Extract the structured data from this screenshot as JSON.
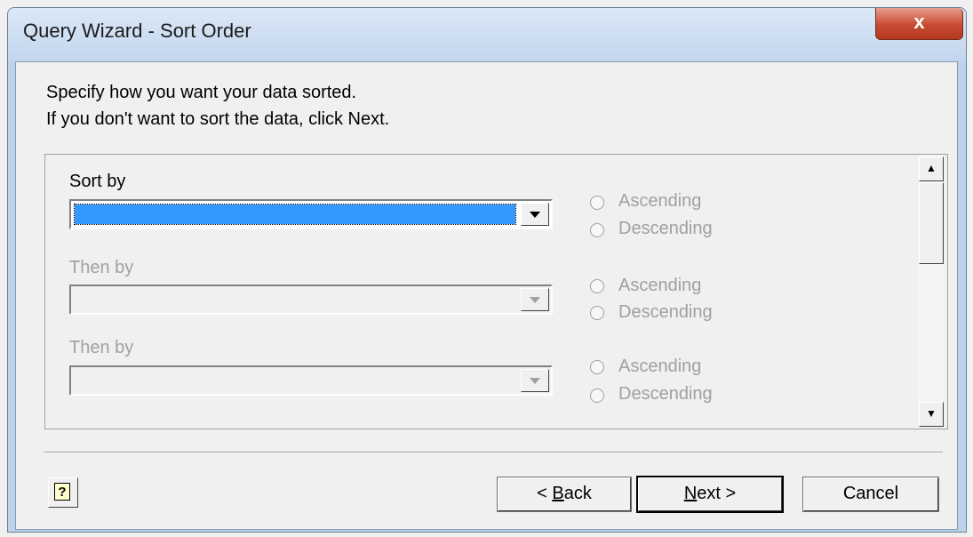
{
  "window": {
    "title": "Query Wizard - Sort Order",
    "close_glyph": "x"
  },
  "instructions": {
    "line1": "Specify how you want your data sorted.",
    "line2": "If you don't want to sort the data, click Next."
  },
  "sort_rows": [
    {
      "label": "Sort by",
      "value": "",
      "ascending": "Ascending",
      "descending": "Descending"
    },
    {
      "label": "Then by",
      "value": "",
      "ascending": "Ascending",
      "descending": "Descending"
    },
    {
      "label": "Then by",
      "value": "",
      "ascending": "Ascending",
      "descending": "Descending"
    }
  ],
  "buttons": {
    "back_pre": "< ",
    "back_key": "B",
    "back_rest": "ack",
    "next_key": "N",
    "next_rest": "ext >",
    "cancel": "Cancel",
    "help_glyph": "?"
  }
}
